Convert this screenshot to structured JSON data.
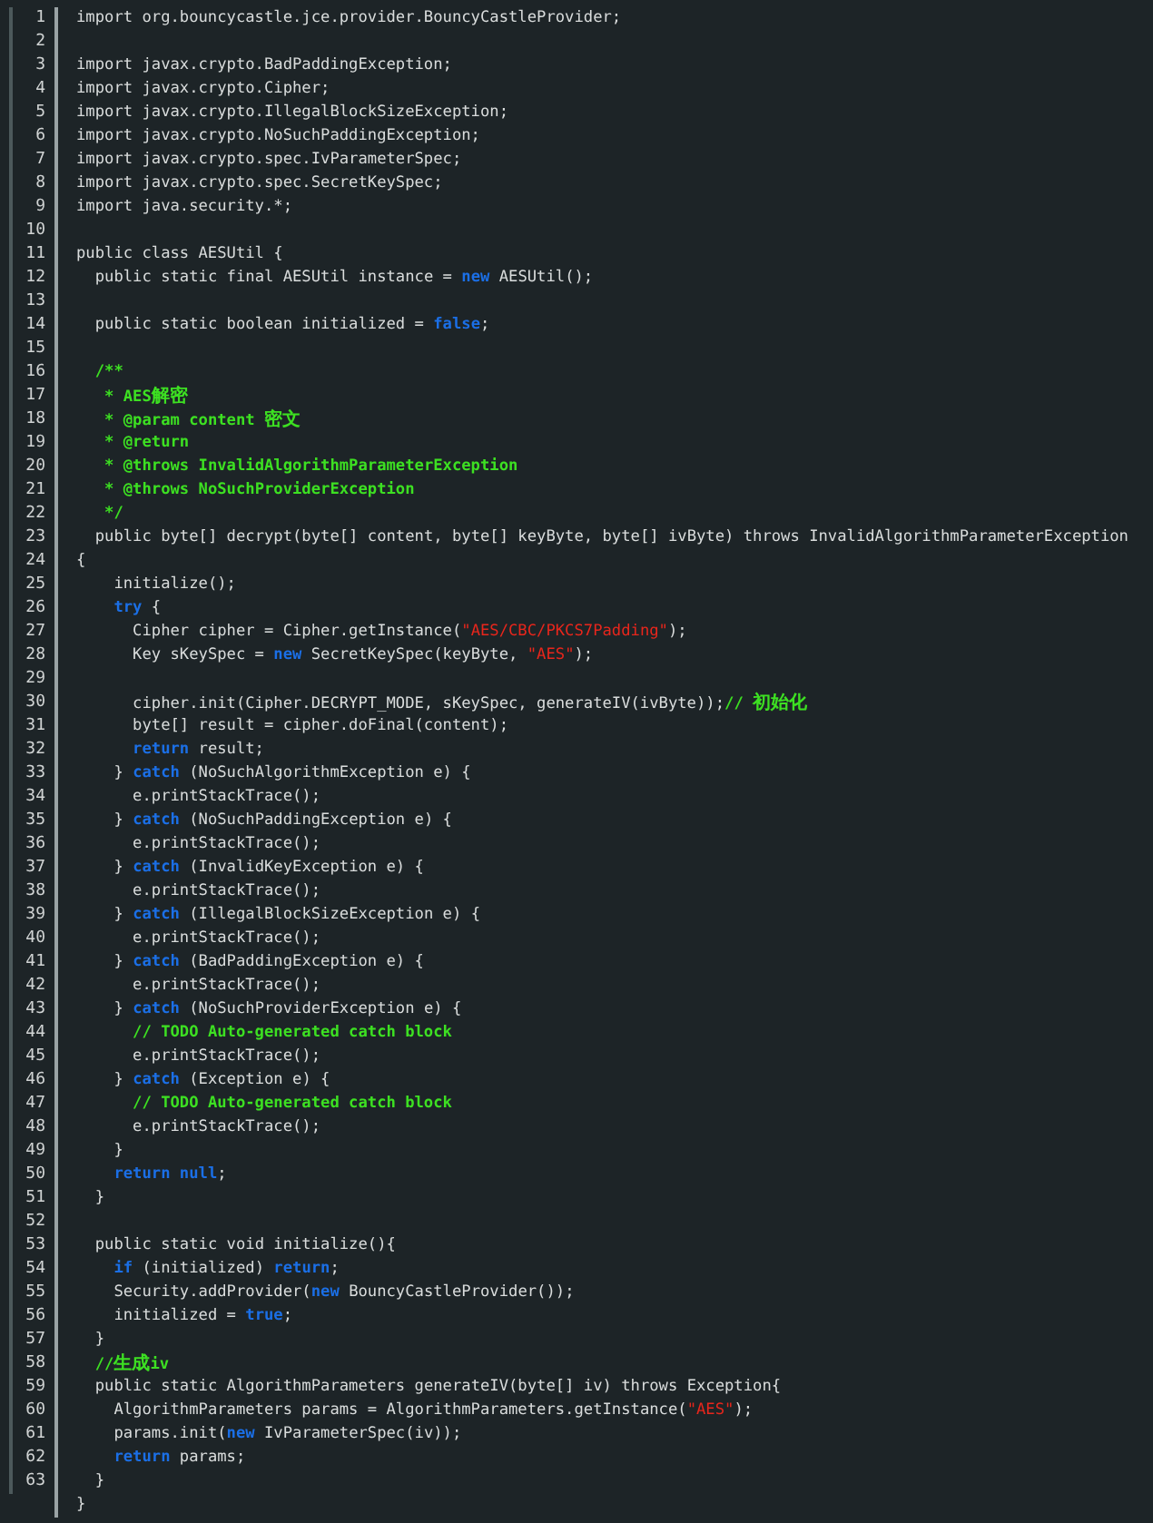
{
  "editor": {
    "lines": [
      {
        "number": "1",
        "tokens": [
          {
            "kind": "plain",
            "text": "import org.bouncycastle.jce.provider.BouncyCastleProvider;"
          }
        ]
      },
      {
        "number": "2"
      },
      {
        "number": "3",
        "tokens": [
          {
            "kind": "plain",
            "text": "import javax.crypto.BadPaddingException;"
          }
        ]
      },
      {
        "number": "4",
        "tokens": [
          {
            "kind": "plain",
            "text": "import javax.crypto.Cipher;"
          }
        ]
      },
      {
        "number": "5",
        "tokens": [
          {
            "kind": "plain",
            "text": "import javax.crypto.IllegalBlockSizeException;"
          }
        ]
      },
      {
        "number": "6",
        "tokens": [
          {
            "kind": "plain",
            "text": "import javax.crypto.NoSuchPaddingException;"
          }
        ]
      },
      {
        "number": "7",
        "tokens": [
          {
            "kind": "plain",
            "text": "import javax.crypto.spec.IvParameterSpec;"
          }
        ]
      },
      {
        "number": "8",
        "tokens": [
          {
            "kind": "plain",
            "text": "import javax.crypto.spec.SecretKeySpec;"
          }
        ]
      },
      {
        "number": "9",
        "tokens": [
          {
            "kind": "plain",
            "text": "import java.security.*;"
          }
        ]
      },
      {
        "number": "10"
      },
      {
        "number": "11",
        "tokens": [
          {
            "kind": "plain",
            "text": "public class AESUtil {"
          }
        ]
      },
      {
        "number": "12",
        "tokens": [
          {
            "kind": "plain",
            "text": "  public static final AESUtil instance = "
          },
          {
            "kind": "keyword",
            "text": "new"
          },
          {
            "kind": "plain",
            "text": " AESUtil();"
          }
        ]
      },
      {
        "number": "13"
      },
      {
        "number": "14",
        "tokens": [
          {
            "kind": "plain",
            "text": "  public static boolean initialized = "
          },
          {
            "kind": "keyword",
            "text": "false"
          },
          {
            "kind": "plain",
            "text": ";"
          }
        ]
      },
      {
        "number": "15"
      },
      {
        "number": "16",
        "tokens": [
          {
            "kind": "comment",
            "text": "  /**"
          }
        ]
      },
      {
        "number": "17",
        "tokens": [
          {
            "kind": "comment",
            "text": "   * AES解密"
          }
        ]
      },
      {
        "number": "18",
        "tokens": [
          {
            "kind": "comment",
            "text": "   * @param content 密文"
          }
        ]
      },
      {
        "number": "19",
        "tokens": [
          {
            "kind": "comment",
            "text": "   * @return"
          }
        ]
      },
      {
        "number": "20",
        "tokens": [
          {
            "kind": "comment",
            "text": "   * @throws InvalidAlgorithmParameterException"
          }
        ]
      },
      {
        "number": "21",
        "tokens": [
          {
            "kind": "comment",
            "text": "   * @throws NoSuchProviderException"
          }
        ]
      },
      {
        "number": "22",
        "tokens": [
          {
            "kind": "comment",
            "text": "   */"
          }
        ]
      },
      {
        "number": "23",
        "tokens": [
          {
            "kind": "plain",
            "text": "  public byte[] decrypt(byte[] content, byte[] keyByte, byte[] ivByte) throws InvalidAlgorithmParameterException"
          }
        ]
      },
      {
        "number": "24",
        "tokens": [
          {
            "kind": "plain",
            "text": "{"
          }
        ]
      },
      {
        "number": "25",
        "tokens": [
          {
            "kind": "plain",
            "text": "    initialize();"
          }
        ]
      },
      {
        "number": "26",
        "tokens": [
          {
            "kind": "keyword",
            "text": "    try"
          },
          {
            "kind": "plain",
            "text": " {"
          }
        ]
      },
      {
        "number": "27",
        "tokens": [
          {
            "kind": "plain",
            "text": "      Cipher cipher = Cipher.getInstance("
          },
          {
            "kind": "string",
            "text": "\"AES/CBC/PKCS7Padding\""
          },
          {
            "kind": "plain",
            "text": ");"
          }
        ]
      },
      {
        "number": "28",
        "tokens": [
          {
            "kind": "plain",
            "text": "      Key sKeySpec = "
          },
          {
            "kind": "keyword",
            "text": "new"
          },
          {
            "kind": "plain",
            "text": " SecretKeySpec(keyByte, "
          },
          {
            "kind": "string",
            "text": "\"AES\""
          },
          {
            "kind": "plain",
            "text": ");"
          }
        ]
      },
      {
        "number": "29"
      },
      {
        "number": "30",
        "tokens": [
          {
            "kind": "plain",
            "text": "      cipher.init(Cipher.DECRYPT_MODE, sKeySpec, generateIV(ivByte));"
          },
          {
            "kind": "comment",
            "text": "// 初始化"
          }
        ]
      },
      {
        "number": "31",
        "tokens": [
          {
            "kind": "plain",
            "text": "      byte[] result = cipher.doFinal(content);"
          }
        ]
      },
      {
        "number": "32",
        "tokens": [
          {
            "kind": "keyword",
            "text": "      return"
          },
          {
            "kind": "plain",
            "text": " result;"
          }
        ]
      },
      {
        "number": "33",
        "tokens": [
          {
            "kind": "plain",
            "text": "    } "
          },
          {
            "kind": "keyword",
            "text": "catch"
          },
          {
            "kind": "plain",
            "text": " (NoSuchAlgorithmException e) {"
          }
        ]
      },
      {
        "number": "34",
        "tokens": [
          {
            "kind": "plain",
            "text": "      e.printStackTrace();"
          }
        ]
      },
      {
        "number": "35",
        "tokens": [
          {
            "kind": "plain",
            "text": "    } "
          },
          {
            "kind": "keyword",
            "text": "catch"
          },
          {
            "kind": "plain",
            "text": " (NoSuchPaddingException e) {"
          }
        ]
      },
      {
        "number": "36",
        "tokens": [
          {
            "kind": "plain",
            "text": "      e.printStackTrace();"
          }
        ]
      },
      {
        "number": "37",
        "tokens": [
          {
            "kind": "plain",
            "text": "    } "
          },
          {
            "kind": "keyword",
            "text": "catch"
          },
          {
            "kind": "plain",
            "text": " (InvalidKeyException e) {"
          }
        ]
      },
      {
        "number": "38",
        "tokens": [
          {
            "kind": "plain",
            "text": "      e.printStackTrace();"
          }
        ]
      },
      {
        "number": "39",
        "tokens": [
          {
            "kind": "plain",
            "text": "    } "
          },
          {
            "kind": "keyword",
            "text": "catch"
          },
          {
            "kind": "plain",
            "text": " (IllegalBlockSizeException e) {"
          }
        ]
      },
      {
        "number": "40",
        "tokens": [
          {
            "kind": "plain",
            "text": "      e.printStackTrace();"
          }
        ]
      },
      {
        "number": "41",
        "tokens": [
          {
            "kind": "plain",
            "text": "    } "
          },
          {
            "kind": "keyword",
            "text": "catch"
          },
          {
            "kind": "plain",
            "text": " (BadPaddingException e) {"
          }
        ]
      },
      {
        "number": "42",
        "tokens": [
          {
            "kind": "plain",
            "text": "      e.printStackTrace();"
          }
        ]
      },
      {
        "number": "43",
        "tokens": [
          {
            "kind": "plain",
            "text": "    } "
          },
          {
            "kind": "keyword",
            "text": "catch"
          },
          {
            "kind": "plain",
            "text": " (NoSuchProviderException e) {"
          }
        ]
      },
      {
        "number": "44",
        "tokens": [
          {
            "kind": "comment",
            "text": "      // TODO Auto-generated catch block"
          }
        ]
      },
      {
        "number": "45",
        "tokens": [
          {
            "kind": "plain",
            "text": "      e.printStackTrace();"
          }
        ]
      },
      {
        "number": "46",
        "tokens": [
          {
            "kind": "plain",
            "text": "    } "
          },
          {
            "kind": "keyword",
            "text": "catch"
          },
          {
            "kind": "plain",
            "text": " (Exception e) {"
          }
        ]
      },
      {
        "number": "47",
        "tokens": [
          {
            "kind": "comment",
            "text": "      // TODO Auto-generated catch block"
          }
        ]
      },
      {
        "number": "48",
        "tokens": [
          {
            "kind": "plain",
            "text": "      e.printStackTrace();"
          }
        ]
      },
      {
        "number": "49",
        "tokens": [
          {
            "kind": "plain",
            "text": "    }"
          }
        ]
      },
      {
        "number": "50",
        "tokens": [
          {
            "kind": "keyword",
            "text": "    return null"
          },
          {
            "kind": "plain",
            "text": ";"
          }
        ]
      },
      {
        "number": "51",
        "tokens": [
          {
            "kind": "plain",
            "text": "  }"
          }
        ]
      },
      {
        "number": "52"
      },
      {
        "number": "53",
        "tokens": [
          {
            "kind": "plain",
            "text": "  public static void initialize(){"
          }
        ]
      },
      {
        "number": "54",
        "tokens": [
          {
            "kind": "keyword",
            "text": "    if"
          },
          {
            "kind": "plain",
            "text": " (initialized) "
          },
          {
            "kind": "keyword",
            "text": "return"
          },
          {
            "kind": "plain",
            "text": ";"
          }
        ]
      },
      {
        "number": "55",
        "tokens": [
          {
            "kind": "plain",
            "text": "    Security.addProvider("
          },
          {
            "kind": "keyword",
            "text": "new"
          },
          {
            "kind": "plain",
            "text": " BouncyCastleProvider());"
          }
        ]
      },
      {
        "number": "56",
        "tokens": [
          {
            "kind": "plain",
            "text": "    initialized = "
          },
          {
            "kind": "keyword",
            "text": "true"
          },
          {
            "kind": "plain",
            "text": ";"
          }
        ]
      },
      {
        "number": "57",
        "tokens": [
          {
            "kind": "plain",
            "text": "  }"
          }
        ]
      },
      {
        "number": "58",
        "tokens": [
          {
            "kind": "comment",
            "text": "  //生成iv"
          }
        ]
      },
      {
        "number": "59",
        "tokens": [
          {
            "kind": "plain",
            "text": "  public static AlgorithmParameters generateIV(byte[] iv) throws Exception{"
          }
        ]
      },
      {
        "number": "60",
        "tokens": [
          {
            "kind": "plain",
            "text": "    AlgorithmParameters params = AlgorithmParameters.getInstance("
          },
          {
            "kind": "string",
            "text": "\"AES\""
          },
          {
            "kind": "plain",
            "text": ");"
          }
        ]
      },
      {
        "number": "61",
        "tokens": [
          {
            "kind": "plain",
            "text": "    params.init("
          },
          {
            "kind": "keyword",
            "text": "new"
          },
          {
            "kind": "plain",
            "text": " IvParameterSpec(iv));"
          }
        ]
      },
      {
        "number": "62",
        "tokens": [
          {
            "kind": "keyword",
            "text": "    return"
          },
          {
            "kind": "plain",
            "text": " params;"
          }
        ]
      },
      {
        "number": "63",
        "tokens": [
          {
            "kind": "plain",
            "text": "  }"
          }
        ]
      },
      {
        "tokens": [
          {
            "kind": "plain",
            "text": "}"
          }
        ]
      }
    ]
  }
}
